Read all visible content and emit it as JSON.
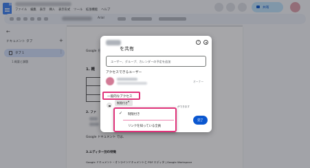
{
  "menu_bar": {
    "items": [
      "ファイル",
      "編集",
      "表示",
      "挿入",
      "表示形式",
      "ツール",
      "拡張機能",
      "ヘルプ"
    ]
  },
  "toolbar": {
    "font_name": "Arial"
  },
  "share_button": {
    "label": "共有"
  },
  "left_panel": {
    "header": "ドキュメント タブ",
    "add_icon": "plus-icon",
    "active_tab": "タブ 1",
    "sub_item": "1.概要と課題"
  },
  "document": {
    "lines": [
      "Google ド",
      "1. 概",
      "2. ファ",
      "Google ドキュメント では、",
      "3.エディター別の特徴",
      "Google ドキュメント・オンラインドキュメントと PDF エディタ | Google Workspace"
    ]
  },
  "share_dialog": {
    "title_suffix": "を共有",
    "search_placeholder": "ユーザー、グループ、カレンダーの予定を追加",
    "access_heading": "アクセスできるユーザー",
    "owner_label": "オーナー",
    "general_access_label": "一般的なアクセス",
    "restriction_selected": "制限付き",
    "restriction_note": "ができます",
    "done_label": "完了"
  },
  "access_dropdown": {
    "options": [
      {
        "label": "制限付き",
        "checked": true
      },
      {
        "label": "リンクを知っている全員",
        "checked": false
      }
    ]
  },
  "colors": {
    "highlight": "#e0337a",
    "primary": "#0b57d0",
    "share_button_bg": "#c2e7ff"
  }
}
